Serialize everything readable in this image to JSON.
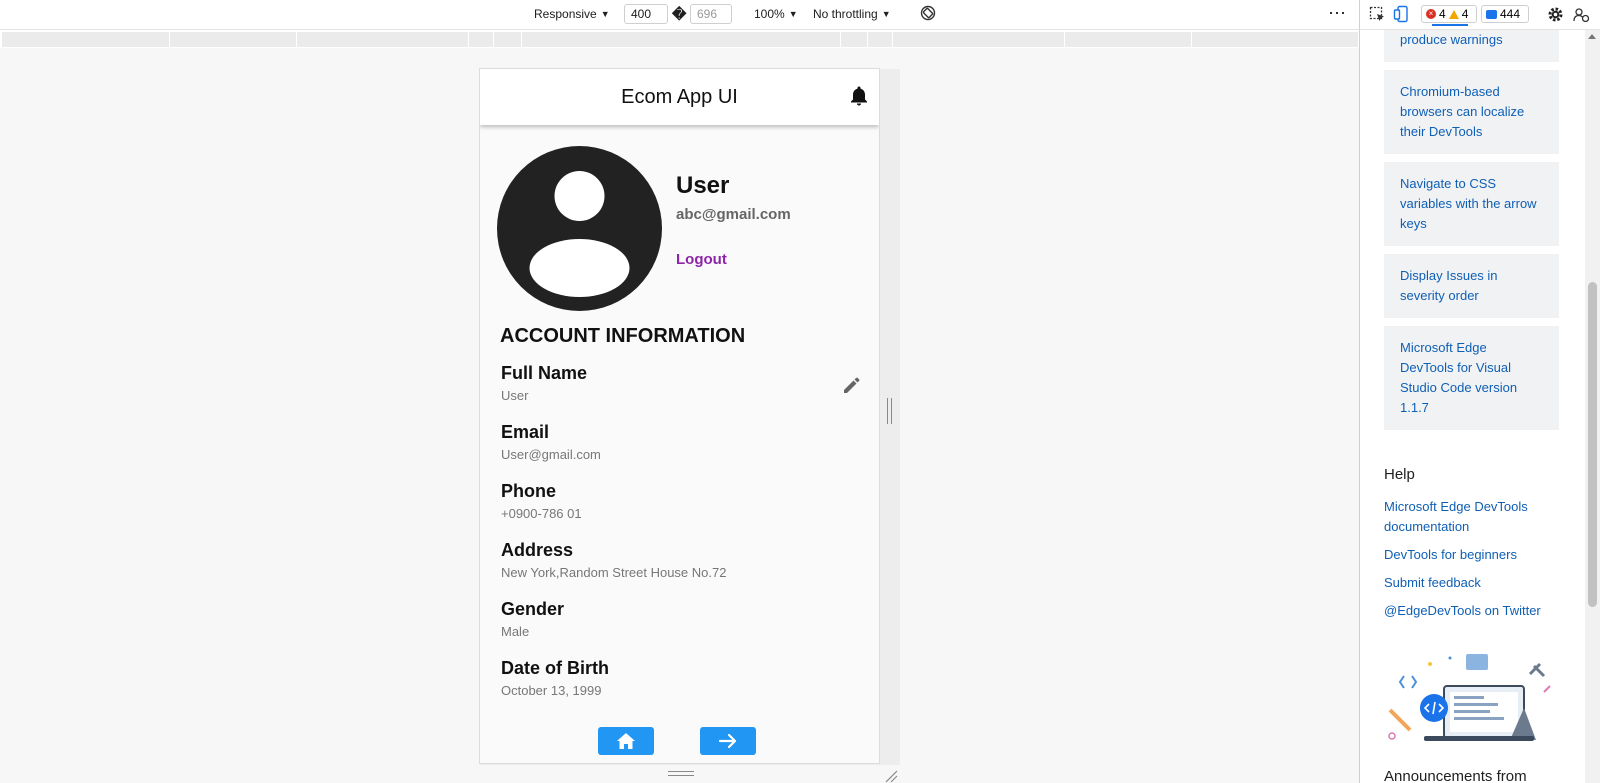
{
  "toolbar": {
    "device_label": "Responsive",
    "width_value": "400",
    "dimension_separator": "�",
    "height_placeholder": "696",
    "zoom_label": "100%",
    "throttle_label": "No throttling",
    "more_label": "⋯",
    "errors_count": "4",
    "warnings_count": "4",
    "messages_count": "444"
  },
  "app": {
    "title": "Ecom App UI",
    "profile": {
      "name": "User",
      "email": "abc@gmail.com",
      "logout_label": "Logout"
    },
    "section_title": "ACCOUNT INFORMATION",
    "fields": [
      {
        "label": "Full Name",
        "value": "User"
      },
      {
        "label": "Email",
        "value": "User@gmail.com"
      },
      {
        "label": "Phone",
        "value": "+0900-786 01"
      },
      {
        "label": "Address",
        "value": "New York,Random Street House No.72"
      },
      {
        "label": "Gender",
        "value": "Male"
      },
      {
        "label": "Date of Birth",
        "value": "October 13, 1999"
      }
    ],
    "accent_color": "#2196f3",
    "logout_color": "#8e24aa"
  },
  "side_panel": {
    "cards": [
      {
        "text": "produce warnings"
      },
      {
        "text": "Chromium-based browsers can localize their DevTools"
      },
      {
        "text": "Navigate to CSS variables with the arrow keys"
      },
      {
        "text": "Display Issues in severity order"
      },
      {
        "text": "Microsoft Edge DevTools for Visual Studio Code version 1.1.7"
      }
    ],
    "help_title": "Help",
    "help_links": [
      {
        "text": "Microsoft Edge DevTools documentation"
      },
      {
        "text": "DevTools for beginners"
      },
      {
        "text": "Submit feedback"
      },
      {
        "text": "@EdgeDevTools on Twitter"
      }
    ],
    "announcements_title": "Announcements from"
  }
}
